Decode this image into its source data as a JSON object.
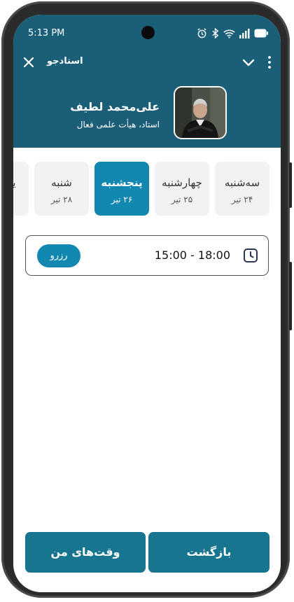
{
  "status_bar": {
    "time": "5:13 PM",
    "icons": [
      "alarm-icon",
      "bluetooth-icon",
      "wifi-icon",
      "signal-icon",
      "battery-icon"
    ]
  },
  "appbar": {
    "title": "استادجو",
    "close_icon": "close-icon",
    "expand_icon": "chevron-down-icon",
    "menu_icon": "more-vert-icon"
  },
  "professor": {
    "name": "علی‌محمد لطیف",
    "subtitle": "استاد، هیأت علمی فعال"
  },
  "days": [
    {
      "name": "سه‌شنبه",
      "date": "۲۴ تیر",
      "active": false
    },
    {
      "name": "چهارشنبه",
      "date": "۲۵ تیر",
      "active": false
    },
    {
      "name": "پنجشنبه",
      "date": "۲۶ تیر",
      "active": true
    },
    {
      "name": "شنبه",
      "date": "۲۸ تیر",
      "active": false
    },
    {
      "name": "یک",
      "date": "",
      "active": false
    }
  ],
  "slot": {
    "time": "15:00 - 18:00",
    "reserve_label": "رزرو"
  },
  "bottom": {
    "back_label": "بازگشت",
    "my_times_label": "وقت‌های من"
  },
  "colors": {
    "header": "#1a5e78",
    "accent": "#1287b0",
    "bottom_button": "#177590"
  }
}
